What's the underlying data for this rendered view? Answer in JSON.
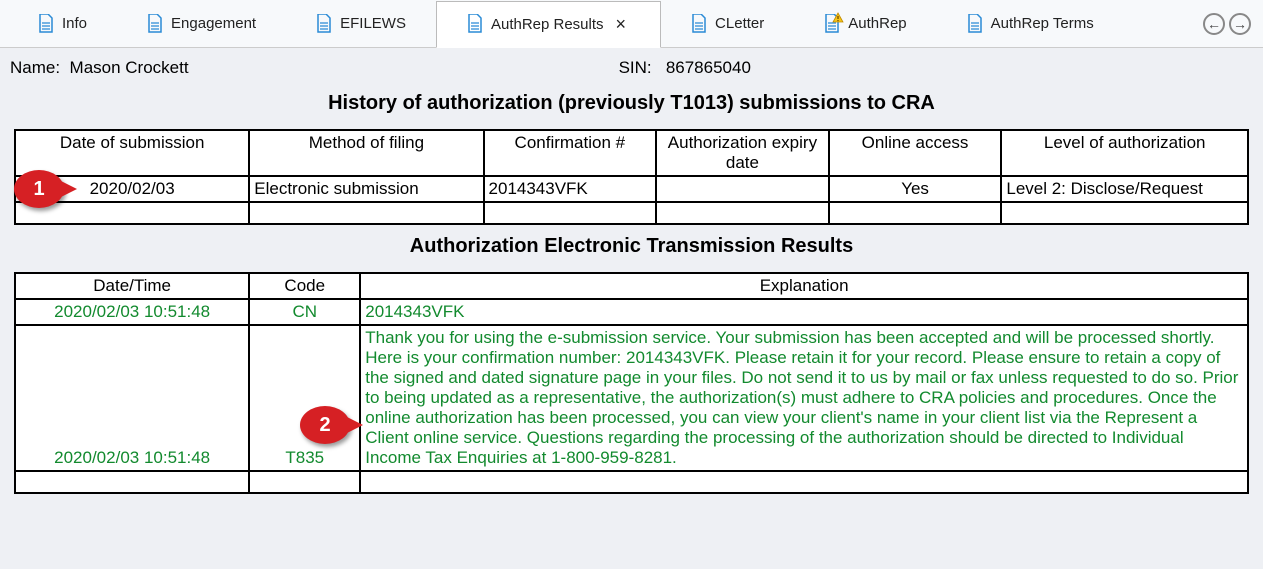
{
  "tabs": [
    {
      "label": "Info"
    },
    {
      "label": "Engagement"
    },
    {
      "label": "EFILEWS"
    },
    {
      "label": "AuthRep Results"
    },
    {
      "label": "CLetter"
    },
    {
      "label": "AuthRep"
    },
    {
      "label": "AuthRep Terms"
    }
  ],
  "meta": {
    "name_label": "Name:",
    "name_value": "Mason Crockett",
    "sin_label": "SIN:",
    "sin_value": "867865040"
  },
  "history": {
    "title": "History of authorization (previously T1013) submissions to CRA",
    "headers": {
      "date": "Date of submission",
      "method": "Method of filing",
      "conf": "Confirmation #",
      "expiry": "Authorization expiry date",
      "online": "Online access",
      "level": "Level of authorization"
    },
    "rows": [
      {
        "date": "2020/02/03",
        "method": "Electronic submission",
        "conf": "2014343VFK",
        "expiry": "",
        "online": "Yes",
        "level": "Level 2: Disclose/Request"
      }
    ]
  },
  "results": {
    "title": "Authorization Electronic Transmission Results",
    "headers": {
      "dt": "Date/Time",
      "cd": "Code",
      "exp": "Explanation"
    },
    "rows": [
      {
        "dt": "2020/02/03 10:51:48",
        "cd": "CN",
        "exp": "2014343VFK"
      },
      {
        "dt": "2020/02/03 10:51:48",
        "cd": "T835",
        "exp": "Thank you for using the e-submission service. Your submission has been accepted and will be processed shortly. Here is your confirmation number: 2014343VFK. Please retain it for your record. Please ensure to retain a copy of the signed and dated signature page in your files. Do not send it to us by mail or fax unless requested to do so. Prior to being updated as a representative, the authorization(s) must adhere to CRA policies and procedures. Once the online authorization has been processed, you can view your client's name in your client list via the Represent a Client online service. Questions regarding the processing of the authorization should be directed to Individual Income Tax Enquiries at 1-800-959-8281."
      }
    ]
  },
  "callouts": {
    "c1": "1",
    "c2": "2"
  }
}
